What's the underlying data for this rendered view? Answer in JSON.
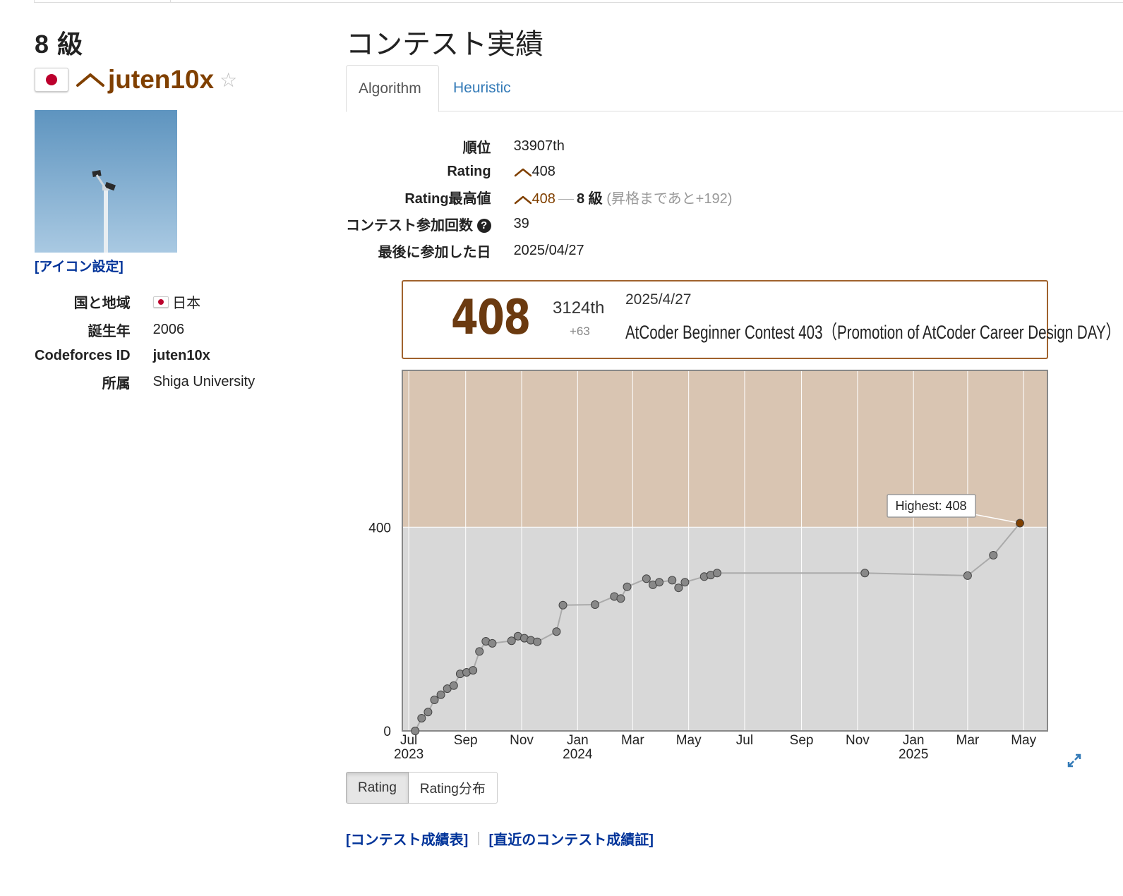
{
  "profile": {
    "grade": "8 級",
    "username": "juten10x",
    "icon_link": "[アイコン設定]",
    "rows": [
      {
        "label": "国と地域",
        "value": "日本",
        "flag": true
      },
      {
        "label": "誕生年",
        "value": "2006"
      },
      {
        "label": "Codeforces ID",
        "value": "juten10x",
        "bold": true
      },
      {
        "label": "所属",
        "value": "Shiga University"
      }
    ]
  },
  "section": {
    "title": "コンテスト実績",
    "tabs": [
      "Algorithm",
      "Heuristic"
    ]
  },
  "stats": {
    "rank_label": "順位",
    "rank_value": "33907th",
    "rating_label": "Rating",
    "rating_value": "408",
    "highest_label": "Rating最高値",
    "highest_value": "408",
    "highest_grade": "8 級",
    "highest_note": "(昇格まであと+192)",
    "count_label": "コンテスト参加回数",
    "count_value": "39",
    "last_label": "最後に参加した日",
    "last_value": "2025/04/27"
  },
  "contest": {
    "rating": "408",
    "rank": "3124th",
    "diff": "+63",
    "date": "2025/4/27",
    "name": "AtCoder Beginner Contest 403（Promotion of AtCoder Career Design DAY）"
  },
  "chart_buttons": [
    "Rating",
    "Rating分布"
  ],
  "bottom_links": [
    "[コンテスト成績表]",
    "[直近のコンテスト成績証]"
  ],
  "colors": {
    "brown": "#804000",
    "gray_band": "#d8d8d8",
    "brown_band": "#d9c5b2",
    "link": "#003399"
  },
  "chart_data": {
    "type": "line",
    "x_ticks": [
      {
        "date": "2023-07-01",
        "label": "Jul",
        "year": "2023"
      },
      {
        "date": "2023-09-01",
        "label": "Sep"
      },
      {
        "date": "2023-11-01",
        "label": "Nov"
      },
      {
        "date": "2024-01-01",
        "label": "Jan",
        "year": "2024"
      },
      {
        "date": "2024-03-01",
        "label": "Mar"
      },
      {
        "date": "2024-05-01",
        "label": "May"
      },
      {
        "date": "2024-07-01",
        "label": "Jul"
      },
      {
        "date": "2024-09-01",
        "label": "Sep"
      },
      {
        "date": "2024-11-01",
        "label": "Nov"
      },
      {
        "date": "2025-01-01",
        "label": "Jan",
        "year": "2025"
      },
      {
        "date": "2025-03-01",
        "label": "Mar"
      },
      {
        "date": "2025-05-01",
        "label": "May"
      }
    ],
    "y_ticks": [
      0,
      400
    ],
    "ylim": [
      0,
      708
    ],
    "xlim": [
      "2023-06-24",
      "2025-05-27"
    ],
    "bands": [
      {
        "from": 0,
        "to": 400,
        "color": "#d8d8d8"
      },
      {
        "from": 400,
        "to": 800,
        "color": "#d9c5b2"
      }
    ],
    "tooltip": "Highest: 408",
    "points": [
      {
        "x": "2023-07-08",
        "y": 0
      },
      {
        "x": "2023-07-15",
        "y": 25
      },
      {
        "x": "2023-07-22",
        "y": 37
      },
      {
        "x": "2023-07-29",
        "y": 61
      },
      {
        "x": "2023-08-05",
        "y": 71
      },
      {
        "x": "2023-08-12",
        "y": 83
      },
      {
        "x": "2023-08-19",
        "y": 89
      },
      {
        "x": "2023-08-26",
        "y": 112
      },
      {
        "x": "2023-09-02",
        "y": 115
      },
      {
        "x": "2023-09-09",
        "y": 119
      },
      {
        "x": "2023-09-16",
        "y": 156
      },
      {
        "x": "2023-09-23",
        "y": 176
      },
      {
        "x": "2023-09-30",
        "y": 172
      },
      {
        "x": "2023-10-21",
        "y": 177
      },
      {
        "x": "2023-10-28",
        "y": 186
      },
      {
        "x": "2023-11-04",
        "y": 182
      },
      {
        "x": "2023-11-11",
        "y": 178
      },
      {
        "x": "2023-11-18",
        "y": 175
      },
      {
        "x": "2023-12-09",
        "y": 195
      },
      {
        "x": "2023-12-16",
        "y": 247
      },
      {
        "x": "2024-01-20",
        "y": 248
      },
      {
        "x": "2024-02-10",
        "y": 264
      },
      {
        "x": "2024-02-17",
        "y": 260
      },
      {
        "x": "2024-02-24",
        "y": 283
      },
      {
        "x": "2024-03-16",
        "y": 299
      },
      {
        "x": "2024-03-23",
        "y": 287
      },
      {
        "x": "2024-03-30",
        "y": 292
      },
      {
        "x": "2024-04-13",
        "y": 296
      },
      {
        "x": "2024-04-20",
        "y": 281
      },
      {
        "x": "2024-04-27",
        "y": 292
      },
      {
        "x": "2024-05-18",
        "y": 303
      },
      {
        "x": "2024-05-25",
        "y": 306
      },
      {
        "x": "2024-06-01",
        "y": 310
      },
      {
        "x": "2024-11-09",
        "y": 310
      },
      {
        "x": "2025-03-01",
        "y": 305
      },
      {
        "x": "2025-03-29",
        "y": 345
      },
      {
        "x": "2025-04-27",
        "y": 408
      }
    ]
  }
}
